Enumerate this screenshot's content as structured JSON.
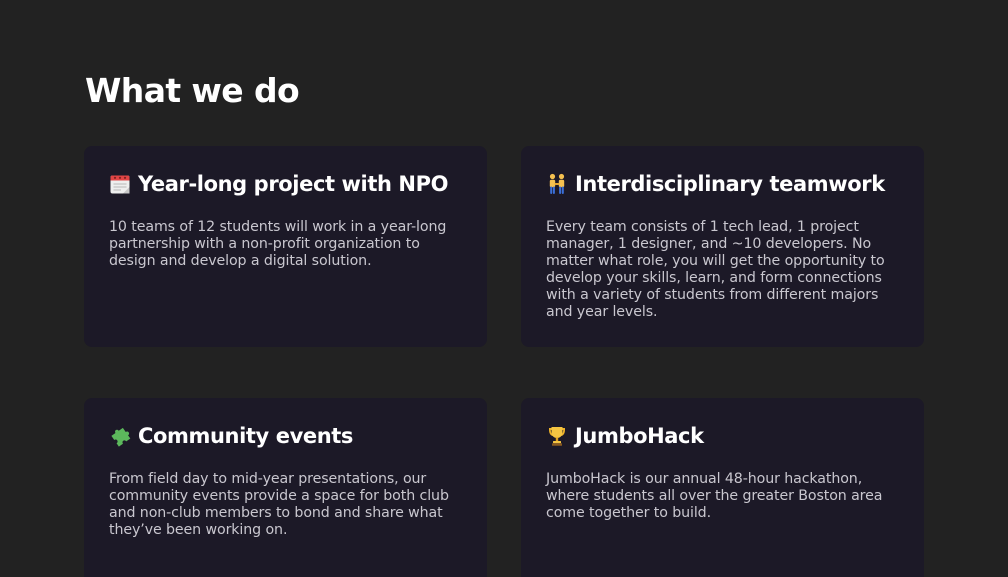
{
  "section": {
    "title": "What we do"
  },
  "cards": [
    {
      "icon": "calendar-icon",
      "title": "Year-long project with NPO",
      "description": "10 teams of 12 students will work in a year-long partnership with a non-profit organization to design and develop a digital solution."
    },
    {
      "icon": "people-holding-hands-icon",
      "title": "Interdisciplinary teamwork",
      "description": "Every team consists of 1 tech lead, 1 project manager, 1 designer, and ~10 developers. No matter what role, you will get the opportunity to develop your skills, learn, and form connections with a variety of students from different majors and year levels."
    },
    {
      "icon": "puzzle-piece-icon",
      "title": "Community events",
      "description": "From field day to mid-year presentations, our community events provide a space for both club and non-club members to bond and share what they’ve been working on."
    },
    {
      "icon": "trophy-icon",
      "title": "JumboHack",
      "description": "JumboHack is our annual 48-hour hackathon, where students all over the greater Boston area come together to build."
    }
  ],
  "colors": {
    "background": "#222222",
    "card": "#1c1927",
    "text": "#ffffff",
    "muted_text": "#c9c7cf"
  }
}
